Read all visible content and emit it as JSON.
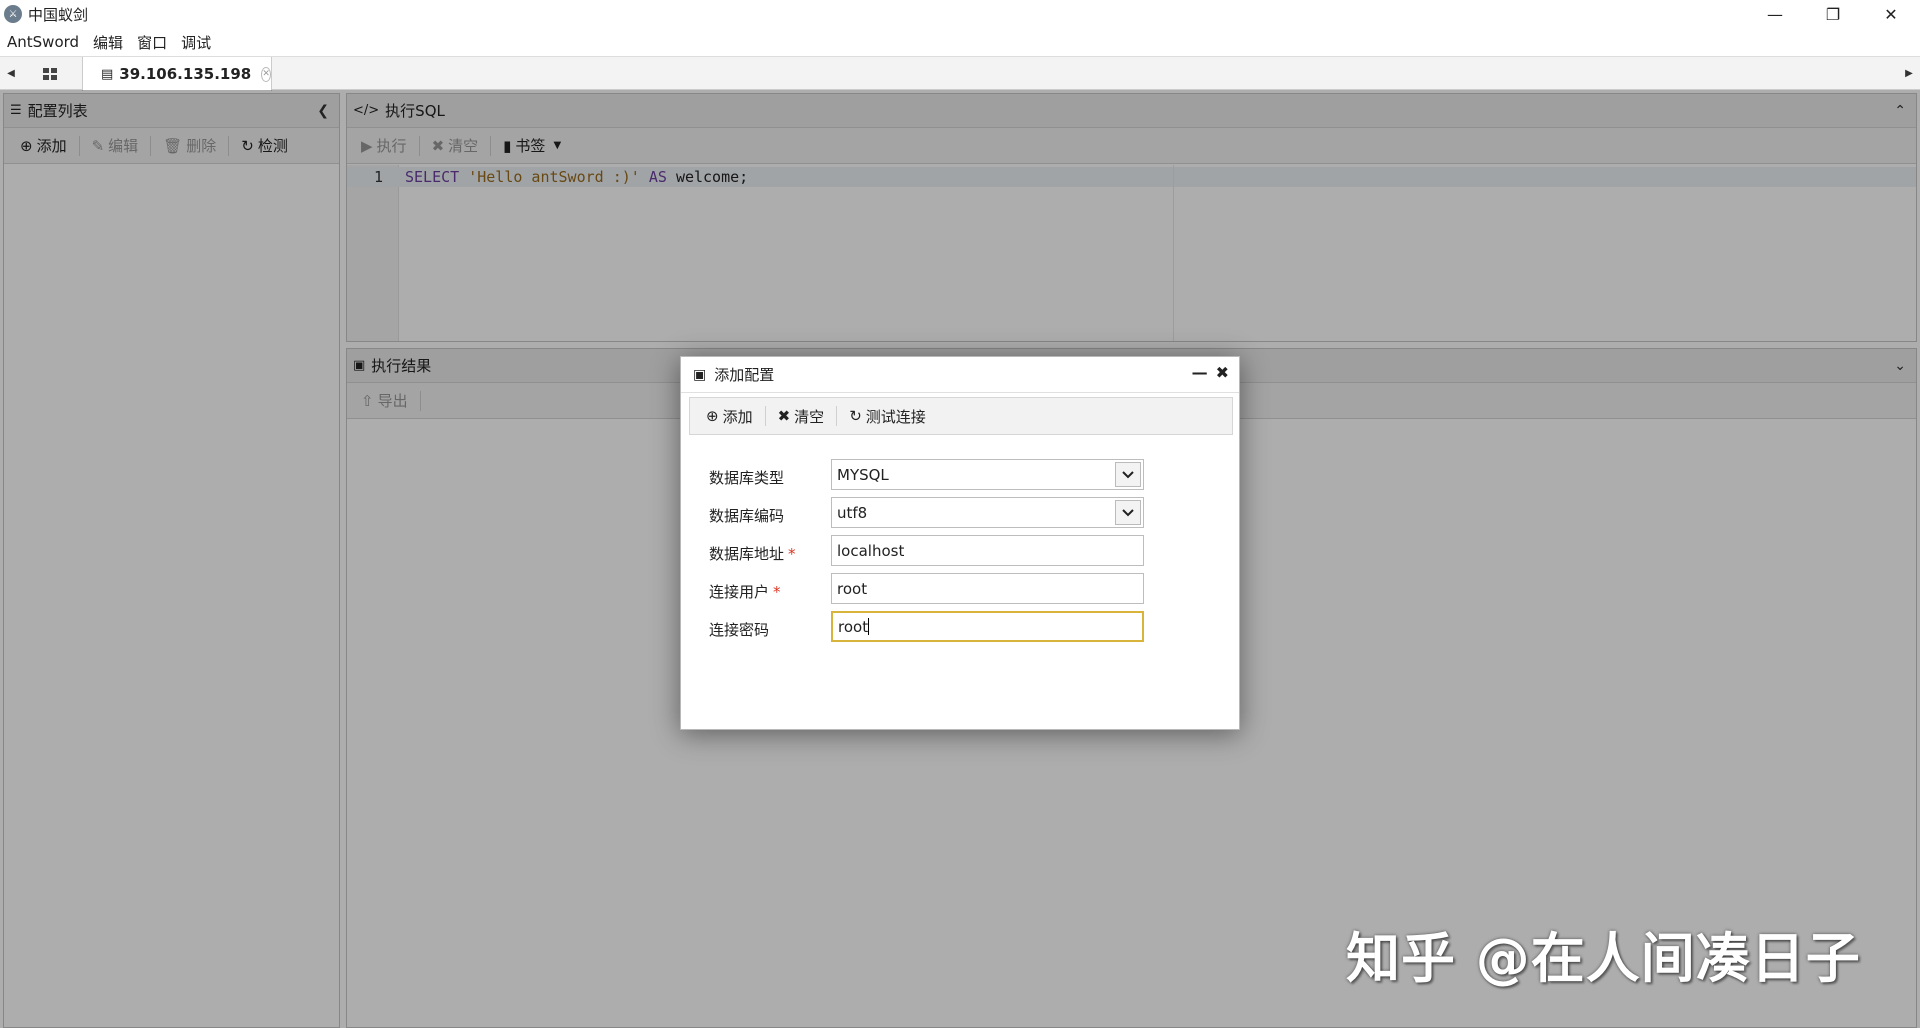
{
  "window": {
    "title": "中国蚁剑",
    "icon": "antsword-logo-icon"
  },
  "menu": [
    "AntSword",
    "编辑",
    "窗口",
    "调试"
  ],
  "tabs": {
    "active_label": "39.106.135.198"
  },
  "left_panel": {
    "title": "配置列表",
    "toolbar": {
      "add": "添加",
      "edit": "编辑",
      "delete": "删除",
      "check": "检测"
    }
  },
  "sql_panel": {
    "title": "执行SQL",
    "toolbar": {
      "execute": "执行",
      "clear": "清空",
      "bookmark": "书签"
    },
    "editor": {
      "line_number": "1",
      "tokens": {
        "select": "SELECT",
        "string": "'Hello antSword :)'",
        "as": "AS",
        "rest": "welcome;"
      }
    }
  },
  "result_panel": {
    "title": "执行结果",
    "toolbar": {
      "export": "导出"
    }
  },
  "dialog": {
    "title": "添加配置",
    "toolbar": {
      "add": "添加",
      "clear": "清空",
      "test": "测试连接"
    },
    "fields": {
      "db_type": {
        "label": "数据库类型",
        "value": "MYSQL"
      },
      "db_encoding": {
        "label": "数据库编码",
        "value": "utf8"
      },
      "db_address": {
        "label": "数据库地址",
        "value": "localhost",
        "required": "*"
      },
      "db_user": {
        "label": "连接用户",
        "value": "root",
        "required": "*"
      },
      "db_password": {
        "label": "连接密码",
        "value": "root"
      }
    }
  },
  "watermark": "知乎 @在人间凑日子",
  "colors": {
    "focus_border": "#d9b43a",
    "required": "#dd3322",
    "sql_keyword": "#6c3fa0",
    "sql_string": "#9a6b1d"
  }
}
